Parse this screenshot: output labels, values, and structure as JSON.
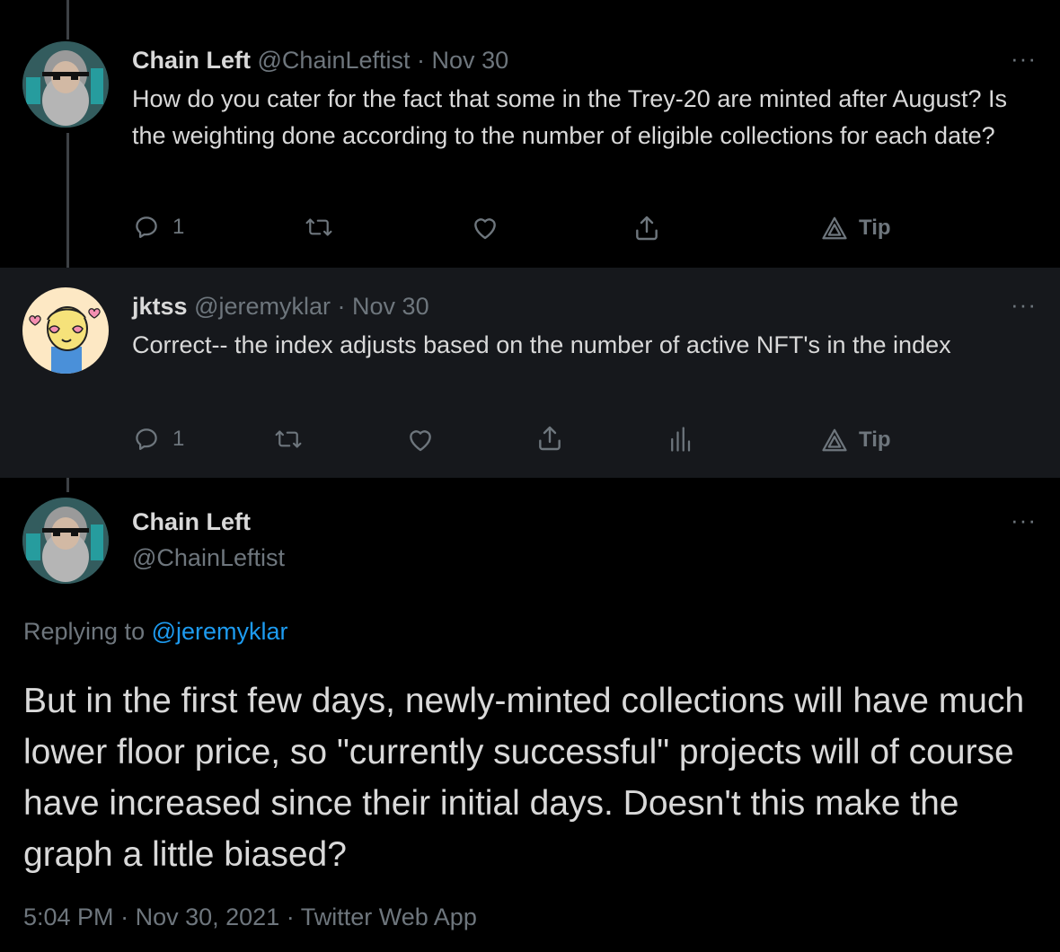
{
  "tweets": [
    {
      "name": "Chain Left",
      "handle": "@ChainLeftist",
      "sep": "·",
      "date": "Nov 30",
      "text": "How do you cater for the fact that some in the Trey-20 are minted after August? Is the weighting done according to the number of eligible collections for each date?",
      "reply_count": "1",
      "tip_label": "Tip"
    },
    {
      "name": "jktss",
      "handle": "@jeremyklar",
      "sep": "·",
      "date": "Nov 30",
      "text": "Correct-- the index adjusts based on the number of active NFT's in the index",
      "reply_count": "1",
      "tip_label": "Tip"
    }
  ],
  "main": {
    "name": "Chain Left",
    "handle": "@ChainLeftist",
    "replying_prefix": "Replying to",
    "replying_handle": "@jeremyklar",
    "text": "But in the first few days, newly-minted collections will have much lower floor price, so \"currently successful\" projects will of course have increased since their initial days. Doesn't this make the graph a little biased?",
    "time": "5:04 PM",
    "sep": "·",
    "date": "Nov 30, 2021",
    "source": "Twitter Web App"
  },
  "more_label": "···",
  "colors": {
    "background": "#000000",
    "highlight_background": "#16181c",
    "text": "#d9d9d9",
    "muted": "#6e767d",
    "link": "#1d9bf0"
  },
  "icons": [
    "reply-icon",
    "retweet-icon",
    "like-icon",
    "share-icon",
    "analytics-icon",
    "tip-icon",
    "more-icon"
  ]
}
